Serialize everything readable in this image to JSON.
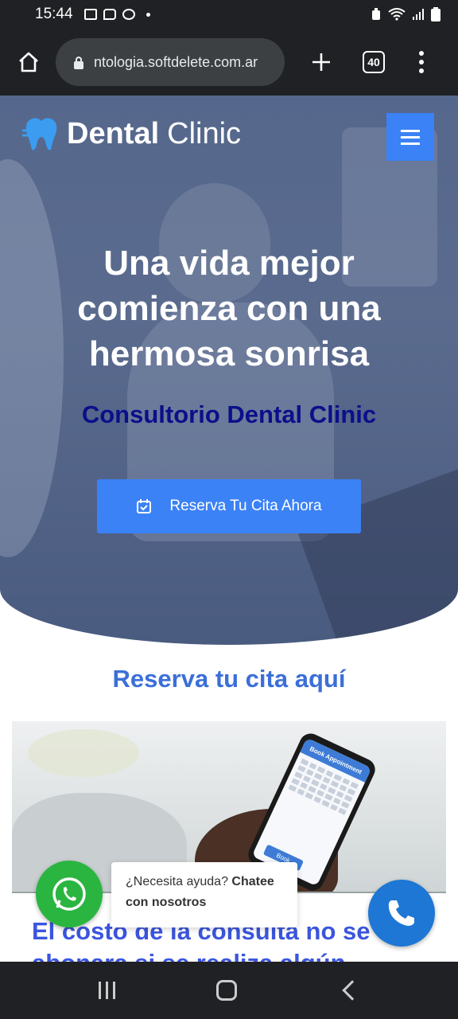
{
  "status_bar": {
    "time": "15:44",
    "left_icons": [
      "image-icon",
      "message-icon",
      "pinwheel-icon"
    ],
    "right_icons": [
      "alarm-icon",
      "wifi-icon",
      "signal-icon",
      "battery-icon"
    ]
  },
  "browser": {
    "url": "ntologia.softdelete.com.ar",
    "tab_count": "40"
  },
  "hero": {
    "logo_strong": "Dental",
    "logo_light": "Clinic",
    "title": "Una vida mejor comienza con una hermosa sonrisa",
    "subtitle": "Consultorio Dental Clinic",
    "cta_label": "Reserva Tu Cita Ahora",
    "accent_color": "#3b82f6",
    "subtitle_color": "#0b0f8a"
  },
  "booking": {
    "section_title": "Reserva tu cita aquí",
    "phone_header": "Book Appointment",
    "phone_button": "Book"
  },
  "cost": {
    "text": "El costo de la consulta no se abonara si se realiza algún"
  },
  "chat": {
    "help_prefix": "¿Necesita ayuda?",
    "help_strong": "Chatee con nosotros",
    "whatsapp_color": "#2ab540",
    "call_color": "#1e77d4"
  }
}
